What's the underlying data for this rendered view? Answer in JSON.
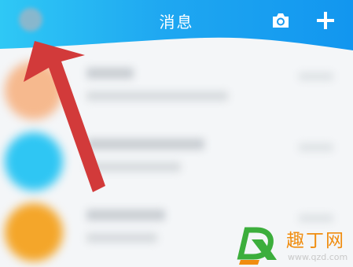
{
  "header": {
    "title": "消息",
    "left_icon": "avatar-icon",
    "right_icons": [
      "camera-icon",
      "plus-icon"
    ],
    "color": "#1fa8f1"
  },
  "conversations": [
    {
      "avatar_color": "#f6b98e"
    },
    {
      "avatar_color": "#2fc6f3"
    },
    {
      "avatar_color": "#f4a62a"
    }
  ],
  "annotation": {
    "arrow_color": "#d23a3a"
  },
  "watermark": {
    "name": "趣丁网",
    "url": "www.qzd.com",
    "colors": [
      "#3cae3c",
      "#f08d10"
    ]
  }
}
